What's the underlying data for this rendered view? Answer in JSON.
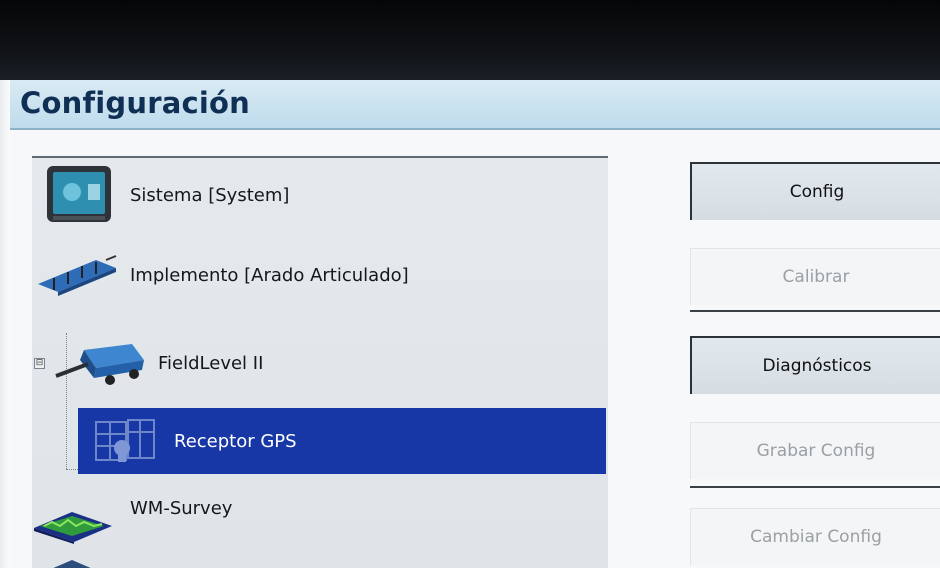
{
  "window": {
    "title": "Configuración"
  },
  "tree": {
    "items": [
      {
        "label": "Sistema [System]",
        "icon": "display-icon"
      },
      {
        "label": "Implemento [Arado Articulado]",
        "icon": "plow-implement-icon"
      },
      {
        "label": "FieldLevel II",
        "icon": "fieldlevel-scraper-icon"
      },
      {
        "label": "Receptor GPS",
        "icon": "gps-receiver-icon",
        "selected": true
      },
      {
        "label": "WM-Survey",
        "icon": "survey-terrain-icon"
      }
    ],
    "expander_symbol": "⊟"
  },
  "actions": {
    "config": "Config",
    "calibrate": "Calibrar",
    "diagnostics": "Diagnósticos",
    "save_config": "Grabar Config",
    "change_config": "Cambiar Config"
  },
  "colors": {
    "title_bar": "#bfdcec",
    "title_text": "#0f2f55",
    "selection": "#1837a6",
    "panel": "#e2e7eb",
    "disabled_text": "#9aa1a6"
  }
}
